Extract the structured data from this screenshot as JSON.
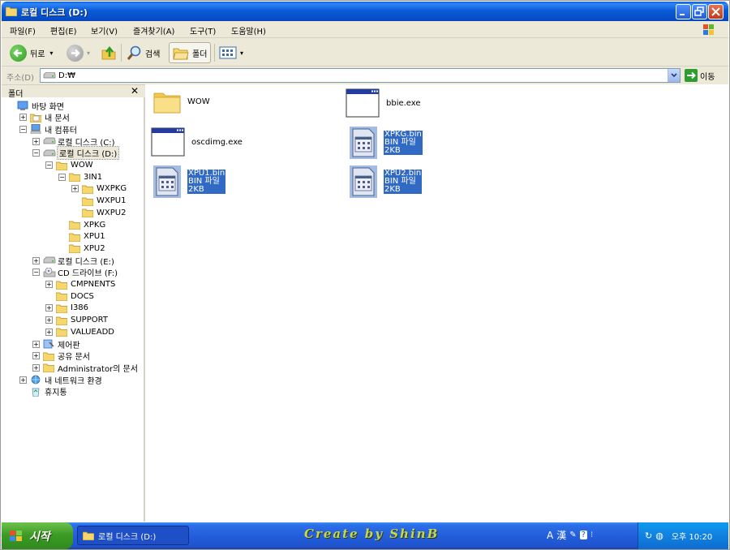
{
  "window": {
    "title": "로컬 디스크 (D:)"
  },
  "menu": [
    "파일(F)",
    "편집(E)",
    "보기(V)",
    "즐겨찾기(A)",
    "도구(T)",
    "도움말(H)"
  ],
  "toolbar": {
    "back_label": "뒤로",
    "search_label": "검색",
    "folders_label": "폴더"
  },
  "address": {
    "label": "주소(D)",
    "value": "D:₩",
    "go_label": "이동"
  },
  "folder_pane": {
    "title": "폴더",
    "close": "✕",
    "tree": [
      {
        "label": "바탕 화면",
        "level": 0,
        "expander": "",
        "icon": "desktop-icon"
      },
      {
        "label": "내 문서",
        "level": 1,
        "expander": "+",
        "icon": "my-documents-icon"
      },
      {
        "label": "내 컴퓨터",
        "level": 1,
        "expander": "−",
        "icon": "my-computer-icon"
      },
      {
        "label": "로컬 디스크 (C:)",
        "level": 2,
        "expander": "+",
        "icon": "drive-icon"
      },
      {
        "label": "로컬 디스크 (D:)",
        "level": 2,
        "expander": "−",
        "icon": "drive-icon",
        "selected": true
      },
      {
        "label": "WOW",
        "level": 3,
        "expander": "−",
        "icon": "folder-icon"
      },
      {
        "label": "3IN1",
        "level": 4,
        "expander": "−",
        "icon": "folder-icon"
      },
      {
        "label": "WXPKG",
        "level": 5,
        "expander": "+",
        "icon": "folder-icon"
      },
      {
        "label": "WXPU1",
        "level": 5,
        "expander": "",
        "icon": "folder-icon"
      },
      {
        "label": "WXPU2",
        "level": 5,
        "expander": "",
        "icon": "folder-icon"
      },
      {
        "label": "XPKG",
        "level": 4,
        "expander": "",
        "icon": "folder-icon"
      },
      {
        "label": "XPU1",
        "level": 4,
        "expander": "",
        "icon": "folder-icon"
      },
      {
        "label": "XPU2",
        "level": 4,
        "expander": "",
        "icon": "folder-icon"
      },
      {
        "label": "로컬 디스크 (E:)",
        "level": 2,
        "expander": "+",
        "icon": "drive-icon"
      },
      {
        "label": "CD 드라이브 (F:)",
        "level": 2,
        "expander": "−",
        "icon": "cd-drive-icon"
      },
      {
        "label": "CMPNENTS",
        "level": 3,
        "expander": "+",
        "icon": "folder-icon"
      },
      {
        "label": "DOCS",
        "level": 3,
        "expander": "",
        "icon": "folder-icon"
      },
      {
        "label": "I386",
        "level": 3,
        "expander": "+",
        "icon": "folder-icon"
      },
      {
        "label": "SUPPORT",
        "level": 3,
        "expander": "+",
        "icon": "folder-icon"
      },
      {
        "label": "VALUEADD",
        "level": 3,
        "expander": "+",
        "icon": "folder-icon"
      },
      {
        "label": "제어판",
        "level": 2,
        "expander": "+",
        "icon": "control-panel-icon"
      },
      {
        "label": "공유 문서",
        "level": 2,
        "expander": "+",
        "icon": "folder-icon"
      },
      {
        "label": "Administrator의 문서",
        "level": 2,
        "expander": "+",
        "icon": "folder-icon"
      },
      {
        "label": "내 네트워크 환경",
        "level": 1,
        "expander": "+",
        "icon": "network-icon"
      },
      {
        "label": "휴지통",
        "level": 1,
        "expander": "",
        "icon": "recycle-bin-icon"
      }
    ]
  },
  "files": [
    {
      "name": "WOW",
      "type": "folder"
    },
    {
      "name": "bbie.exe",
      "type": "exe"
    },
    {
      "name": "oscdimg.exe",
      "type": "exe"
    },
    {
      "name": "XPKG.bin",
      "sub1": "BIN 파일",
      "sub2": "2KB",
      "type": "bin",
      "selected": true
    },
    {
      "name": "XPU1.bin",
      "sub1": "BIN 파일",
      "sub2": "2KB",
      "type": "bin",
      "selected": true
    },
    {
      "name": "XPU2.bin",
      "sub1": "BIN 파일",
      "sub2": "2KB",
      "type": "bin",
      "selected": true
    }
  ],
  "taskbar": {
    "start_label": "시작",
    "task_label": "로컬 디스크 (D:)",
    "watermark": "Create by ShinB",
    "ime_a": "A",
    "ime_han": "漢",
    "clock": "오후 10:20"
  }
}
